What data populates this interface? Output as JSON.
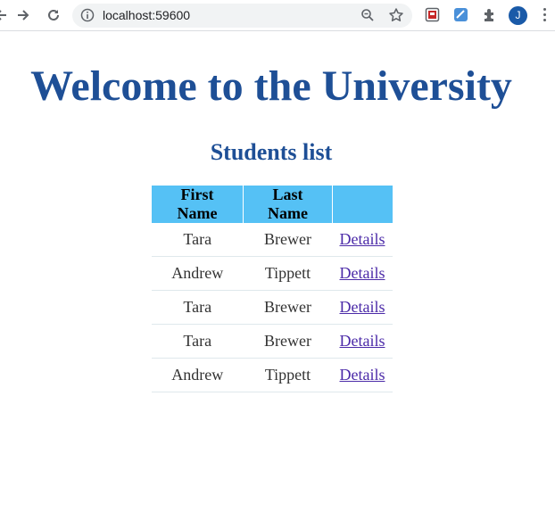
{
  "browser": {
    "url": "localhost:59600",
    "avatar_letter": "J",
    "icons": [
      "back-arrow-icon",
      "forward-arrow-icon",
      "reload-icon",
      "info-icon",
      "zoom-icon",
      "star-icon",
      "extension-1-icon",
      "extension-2-icon",
      "puzzle-icon",
      "kebab-menu-icon"
    ]
  },
  "page": {
    "title": "Welcome to the University",
    "subtitle": "Students list"
  },
  "table": {
    "headers": [
      "First Name",
      "Last Name",
      ""
    ],
    "rows": [
      {
        "first": "Tara",
        "last": "Brewer",
        "link": "Details"
      },
      {
        "first": "Andrew",
        "last": "Tippett",
        "link": "Details"
      },
      {
        "first": "Tara",
        "last": "Brewer",
        "link": "Details"
      },
      {
        "first": "Tara",
        "last": "Brewer",
        "link": "Details"
      },
      {
        "first": "Andrew",
        "last": "Tippett",
        "link": "Details"
      }
    ]
  },
  "colors": {
    "heading": "#1e4f96",
    "table_header_bg": "#55c1f5",
    "link": "#4b2aa8"
  }
}
